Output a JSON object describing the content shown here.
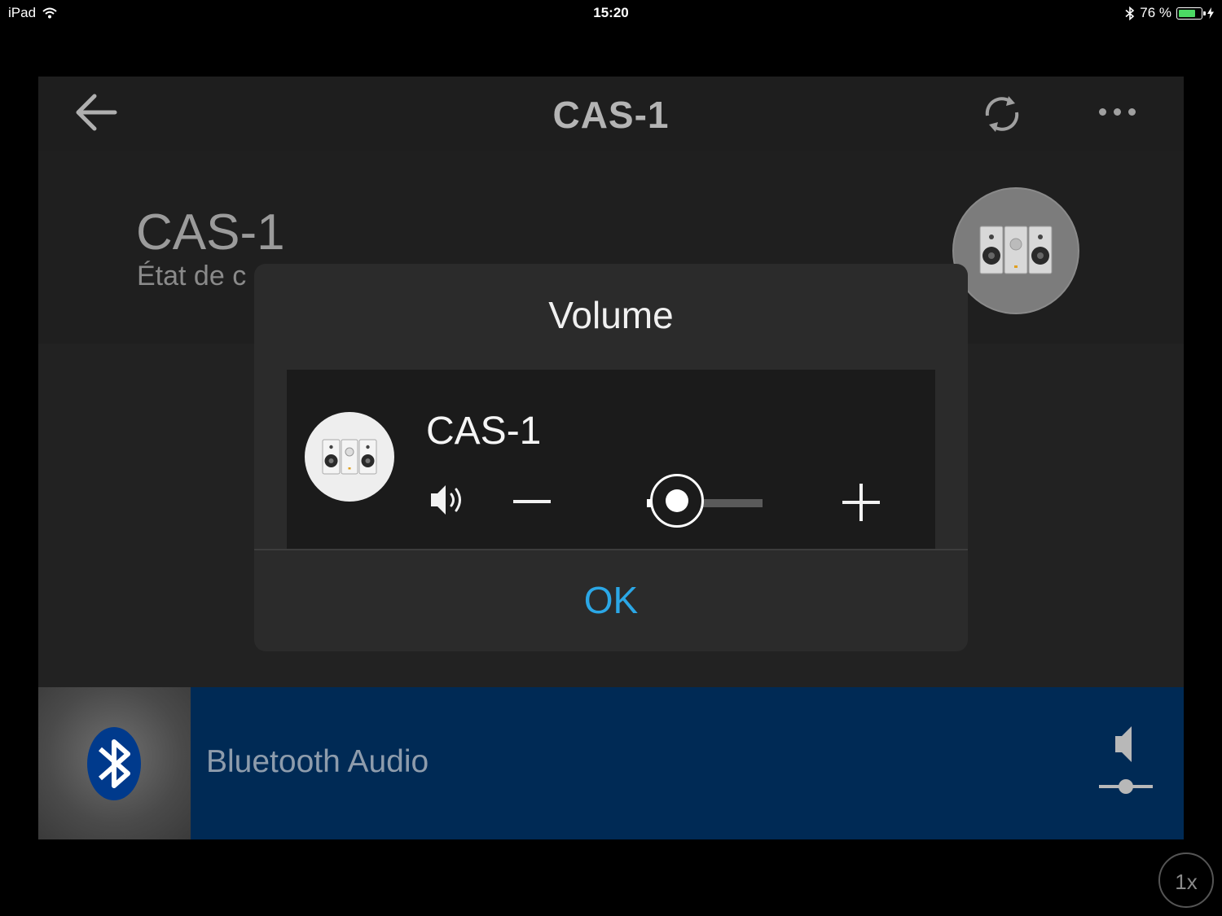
{
  "status_bar": {
    "device": "iPad",
    "time": "15:20",
    "battery_text": "76 %",
    "battery_level": 0.76
  },
  "app": {
    "title": "CAS-1",
    "icons": {
      "back": "back-arrow-icon",
      "sync": "sync-icon",
      "more": "more-icon"
    }
  },
  "device_header": {
    "name": "CAS-1",
    "status_partial": "État de c"
  },
  "volume_dialog": {
    "title": "Volume",
    "device_name": "CAS-1",
    "volume_level": 0.22,
    "ok_label": "OK"
  },
  "now_playing": {
    "source": "Bluetooth Audio"
  },
  "playback_speed": "1x",
  "colors": {
    "accent": "#2ba7e6",
    "now_playing_bar": "#002a55",
    "battery": "#4cd964"
  }
}
